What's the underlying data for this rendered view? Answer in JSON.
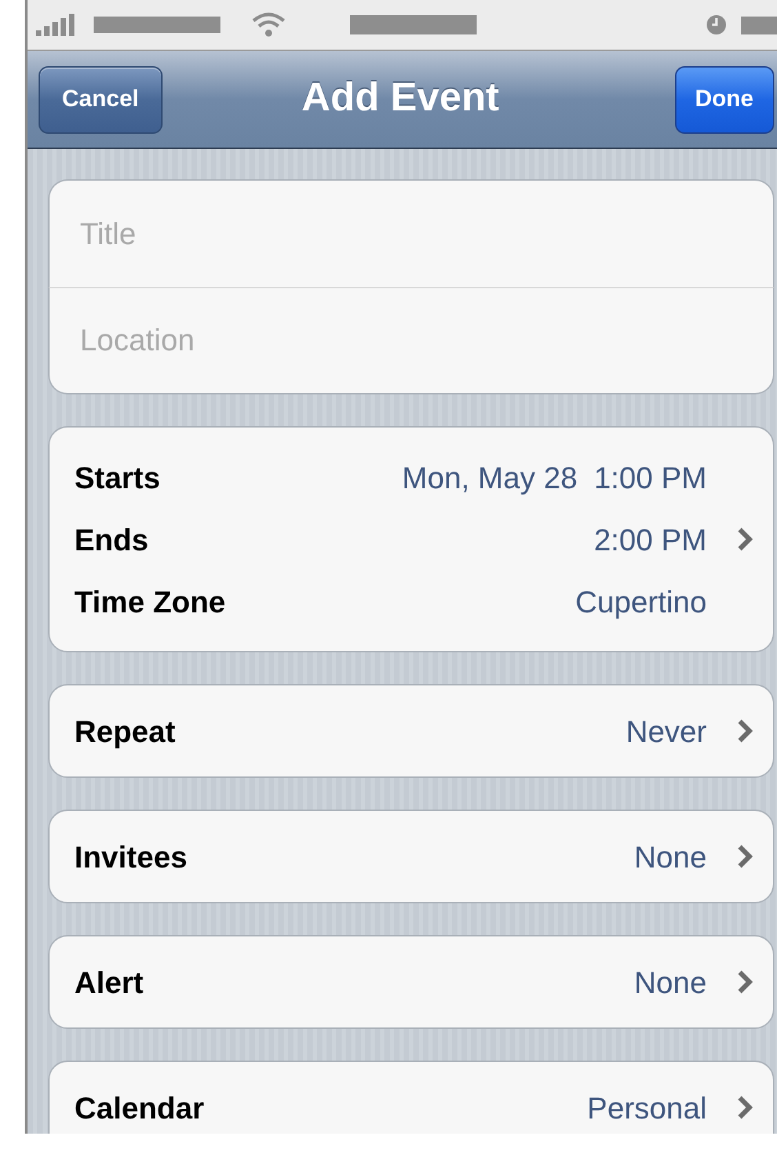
{
  "nav_bar": {
    "left_button": "Cancel",
    "title": "Add Event",
    "right_button": "Done"
  },
  "text_fields": [
    {
      "placeholder": "Title"
    },
    {
      "placeholder": "Location"
    }
  ],
  "time_group": [
    {
      "label": "Starts",
      "values": [
        "Mon, May 28",
        "1:00 PM"
      ],
      "chevron": false
    },
    {
      "label": "Ends",
      "values": [
        "2:00 PM"
      ],
      "chevron": true
    },
    {
      "label": "Time Zone",
      "values": [
        "Cupertino"
      ],
      "chevron": false
    }
  ],
  "settings": [
    {
      "label": "Repeat",
      "value": "Never",
      "chevron": true
    },
    {
      "label": "Invitees",
      "value": "None",
      "chevron": true
    },
    {
      "label": "Alert",
      "value": "None",
      "chevron": true
    },
    {
      "label": "Calendar",
      "value": "Personal",
      "chevron": true
    }
  ]
}
